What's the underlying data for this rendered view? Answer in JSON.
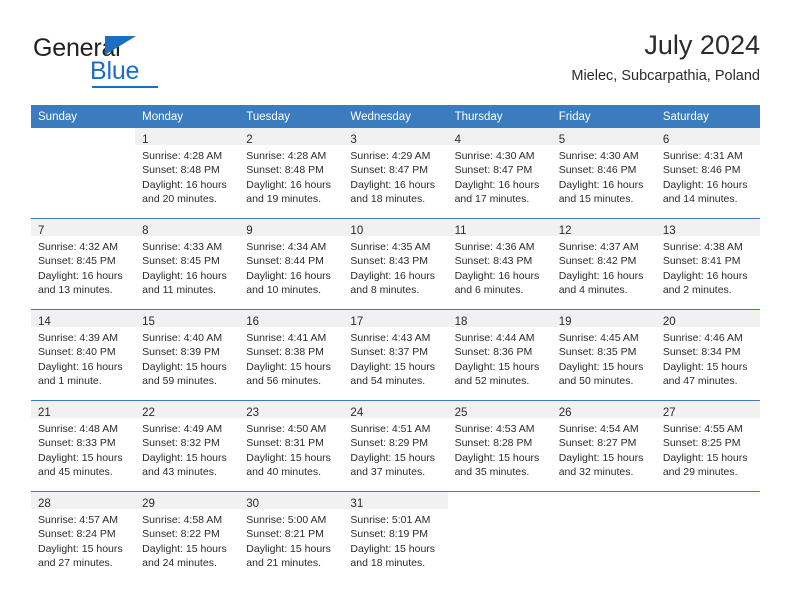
{
  "brand": {
    "name_dark": "General",
    "name_blue": "Blue",
    "accent_color": "#1b6ec2"
  },
  "header": {
    "title": "July 2024",
    "subtitle": "Mielec, Subcarpathia, Poland"
  },
  "theme": {
    "header_blue": "#3a7cbe",
    "daynum_band": "#f1f1f1",
    "text": "#2b2b2b"
  },
  "weekday_headers": [
    "Sunday",
    "Monday",
    "Tuesday",
    "Wednesday",
    "Thursday",
    "Friday",
    "Saturday"
  ],
  "weeks": [
    [
      {
        "day": "",
        "lines": []
      },
      {
        "day": "1",
        "lines": [
          "Sunrise: 4:28 AM",
          "Sunset: 8:48 PM",
          "Daylight: 16 hours",
          "and 20 minutes."
        ]
      },
      {
        "day": "2",
        "lines": [
          "Sunrise: 4:28 AM",
          "Sunset: 8:48 PM",
          "Daylight: 16 hours",
          "and 19 minutes."
        ]
      },
      {
        "day": "3",
        "lines": [
          "Sunrise: 4:29 AM",
          "Sunset: 8:47 PM",
          "Daylight: 16 hours",
          "and 18 minutes."
        ]
      },
      {
        "day": "4",
        "lines": [
          "Sunrise: 4:30 AM",
          "Sunset: 8:47 PM",
          "Daylight: 16 hours",
          "and 17 minutes."
        ]
      },
      {
        "day": "5",
        "lines": [
          "Sunrise: 4:30 AM",
          "Sunset: 8:46 PM",
          "Daylight: 16 hours",
          "and 15 minutes."
        ]
      },
      {
        "day": "6",
        "lines": [
          "Sunrise: 4:31 AM",
          "Sunset: 8:46 PM",
          "Daylight: 16 hours",
          "and 14 minutes."
        ]
      }
    ],
    [
      {
        "day": "7",
        "lines": [
          "Sunrise: 4:32 AM",
          "Sunset: 8:45 PM",
          "Daylight: 16 hours",
          "and 13 minutes."
        ]
      },
      {
        "day": "8",
        "lines": [
          "Sunrise: 4:33 AM",
          "Sunset: 8:45 PM",
          "Daylight: 16 hours",
          "and 11 minutes."
        ]
      },
      {
        "day": "9",
        "lines": [
          "Sunrise: 4:34 AM",
          "Sunset: 8:44 PM",
          "Daylight: 16 hours",
          "and 10 minutes."
        ]
      },
      {
        "day": "10",
        "lines": [
          "Sunrise: 4:35 AM",
          "Sunset: 8:43 PM",
          "Daylight: 16 hours",
          "and 8 minutes."
        ]
      },
      {
        "day": "11",
        "lines": [
          "Sunrise: 4:36 AM",
          "Sunset: 8:43 PM",
          "Daylight: 16 hours",
          "and 6 minutes."
        ]
      },
      {
        "day": "12",
        "lines": [
          "Sunrise: 4:37 AM",
          "Sunset: 8:42 PM",
          "Daylight: 16 hours",
          "and 4 minutes."
        ]
      },
      {
        "day": "13",
        "lines": [
          "Sunrise: 4:38 AM",
          "Sunset: 8:41 PM",
          "Daylight: 16 hours",
          "and 2 minutes."
        ]
      }
    ],
    [
      {
        "day": "14",
        "lines": [
          "Sunrise: 4:39 AM",
          "Sunset: 8:40 PM",
          "Daylight: 16 hours",
          "and 1 minute."
        ]
      },
      {
        "day": "15",
        "lines": [
          "Sunrise: 4:40 AM",
          "Sunset: 8:39 PM",
          "Daylight: 15 hours",
          "and 59 minutes."
        ]
      },
      {
        "day": "16",
        "lines": [
          "Sunrise: 4:41 AM",
          "Sunset: 8:38 PM",
          "Daylight: 15 hours",
          "and 56 minutes."
        ]
      },
      {
        "day": "17",
        "lines": [
          "Sunrise: 4:43 AM",
          "Sunset: 8:37 PM",
          "Daylight: 15 hours",
          "and 54 minutes."
        ]
      },
      {
        "day": "18",
        "lines": [
          "Sunrise: 4:44 AM",
          "Sunset: 8:36 PM",
          "Daylight: 15 hours",
          "and 52 minutes."
        ]
      },
      {
        "day": "19",
        "lines": [
          "Sunrise: 4:45 AM",
          "Sunset: 8:35 PM",
          "Daylight: 15 hours",
          "and 50 minutes."
        ]
      },
      {
        "day": "20",
        "lines": [
          "Sunrise: 4:46 AM",
          "Sunset: 8:34 PM",
          "Daylight: 15 hours",
          "and 47 minutes."
        ]
      }
    ],
    [
      {
        "day": "21",
        "lines": [
          "Sunrise: 4:48 AM",
          "Sunset: 8:33 PM",
          "Daylight: 15 hours",
          "and 45 minutes."
        ]
      },
      {
        "day": "22",
        "lines": [
          "Sunrise: 4:49 AM",
          "Sunset: 8:32 PM",
          "Daylight: 15 hours",
          "and 43 minutes."
        ]
      },
      {
        "day": "23",
        "lines": [
          "Sunrise: 4:50 AM",
          "Sunset: 8:31 PM",
          "Daylight: 15 hours",
          "and 40 minutes."
        ]
      },
      {
        "day": "24",
        "lines": [
          "Sunrise: 4:51 AM",
          "Sunset: 8:29 PM",
          "Daylight: 15 hours",
          "and 37 minutes."
        ]
      },
      {
        "day": "25",
        "lines": [
          "Sunrise: 4:53 AM",
          "Sunset: 8:28 PM",
          "Daylight: 15 hours",
          "and 35 minutes."
        ]
      },
      {
        "day": "26",
        "lines": [
          "Sunrise: 4:54 AM",
          "Sunset: 8:27 PM",
          "Daylight: 15 hours",
          "and 32 minutes."
        ]
      },
      {
        "day": "27",
        "lines": [
          "Sunrise: 4:55 AM",
          "Sunset: 8:25 PM",
          "Daylight: 15 hours",
          "and 29 minutes."
        ]
      }
    ],
    [
      {
        "day": "28",
        "lines": [
          "Sunrise: 4:57 AM",
          "Sunset: 8:24 PM",
          "Daylight: 15 hours",
          "and 27 minutes."
        ]
      },
      {
        "day": "29",
        "lines": [
          "Sunrise: 4:58 AM",
          "Sunset: 8:22 PM",
          "Daylight: 15 hours",
          "and 24 minutes."
        ]
      },
      {
        "day": "30",
        "lines": [
          "Sunrise: 5:00 AM",
          "Sunset: 8:21 PM",
          "Daylight: 15 hours",
          "and 21 minutes."
        ]
      },
      {
        "day": "31",
        "lines": [
          "Sunrise: 5:01 AM",
          "Sunset: 8:19 PM",
          "Daylight: 15 hours",
          "and 18 minutes."
        ]
      },
      {
        "day": "",
        "lines": []
      },
      {
        "day": "",
        "lines": []
      },
      {
        "day": "",
        "lines": []
      }
    ]
  ]
}
